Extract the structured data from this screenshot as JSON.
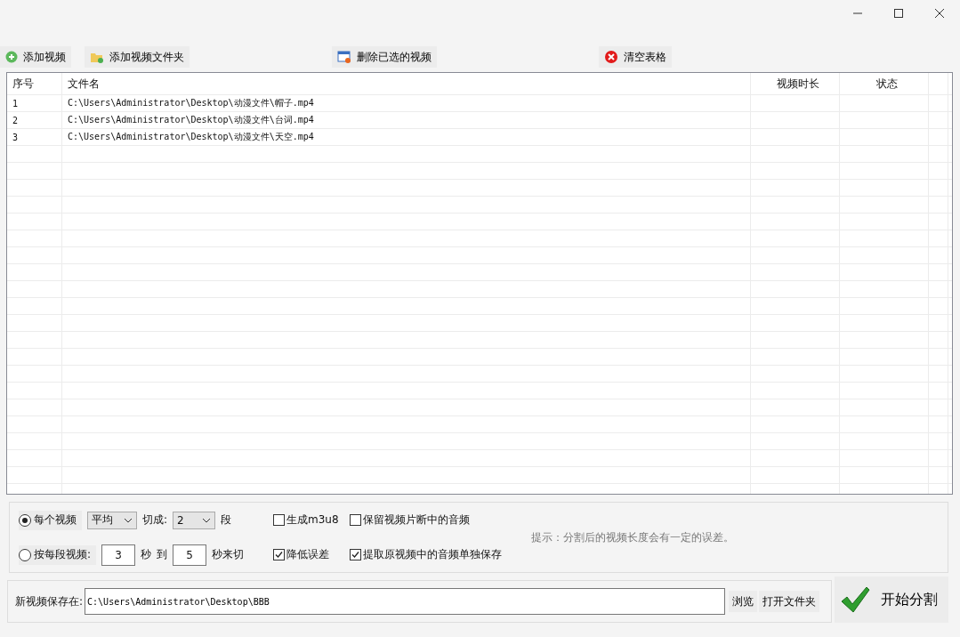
{
  "toolbar": [
    {
      "kind": "add",
      "label": "添加视频"
    },
    {
      "kind": "folder",
      "label": "添加视频文件夹"
    },
    {
      "kind": "delete",
      "label": "删除已选的视频"
    },
    {
      "kind": "clear",
      "label": "清空表格"
    }
  ],
  "table": {
    "columns": [
      "序号",
      "文件名",
      "视频时长",
      "状态"
    ],
    "rows": [
      [
        "1",
        "C:\\Users\\Administrator\\Desktop\\动漫文件\\帽子.mp4"
      ],
      [
        "2",
        "C:\\Users\\Administrator\\Desktop\\动漫文件\\台词.mp4"
      ],
      [
        "3",
        "C:\\Users\\Administrator\\Desktop\\动漫文件\\天空.mp4"
      ]
    ]
  },
  "options": {
    "mode_each": {
      "label": "每个视频",
      "selected": true,
      "method": "平均",
      "cut_label": "切成:",
      "count": "2",
      "unit": "段"
    },
    "mode_seconds": {
      "label": "按每段视频:",
      "selected": false,
      "from": "3",
      "sec": "秒",
      "to": "到",
      "until": "5",
      "tail": "秒来切"
    },
    "checks": [
      {
        "label": "生成m3u8",
        "checked": false
      },
      {
        "label": "保留视频片断中的音频",
        "checked": false
      },
      {
        "label": "降低误差",
        "checked": true
      },
      {
        "label": "提取原视频中的音频单独保存",
        "checked": true
      }
    ],
    "hint": "提示：分割后的视频长度会有一定的误差。"
  },
  "output": {
    "label": "新视频保存在:",
    "value": "C:\\Users\\Administrator\\Desktop\\BBB",
    "browse": "浏览",
    "open": "打开文件夹"
  },
  "start": "开始分割"
}
